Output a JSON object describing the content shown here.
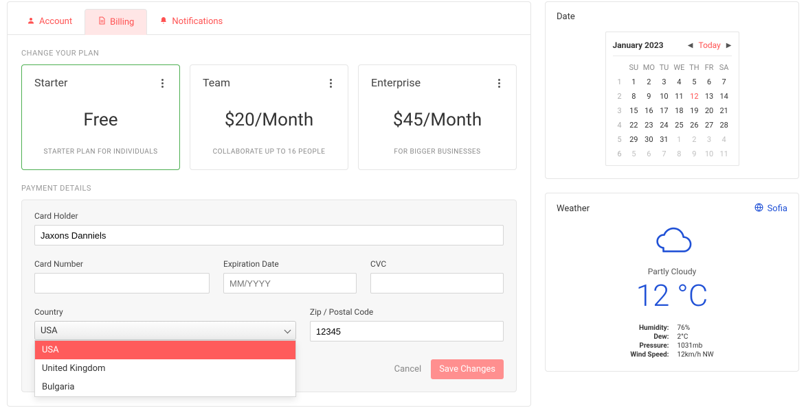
{
  "tabs": {
    "account": "Account",
    "billing": "Billing",
    "notifications": "Notifications"
  },
  "sections": {
    "plan_label": "CHANGE YOUR PLAN",
    "payment_label": "PAYMENT DETAILS"
  },
  "plans": [
    {
      "name": "Starter",
      "price": "Free",
      "desc": "STARTER PLAN FOR INDIVIDUALS",
      "selected": true
    },
    {
      "name": "Team",
      "price": "$20/Month",
      "desc": "COLLABORATE UP TO 16 PEOPLE",
      "selected": false
    },
    {
      "name": "Enterprise",
      "price": "$45/Month",
      "desc": "FOR BIGGER BUSINESSES",
      "selected": false
    }
  ],
  "form": {
    "card_holder": {
      "label": "Card Holder",
      "value": "Jaxons Danniels"
    },
    "card_number": {
      "label": "Card Number",
      "value": ""
    },
    "expiration": {
      "label": "Expiration Date",
      "placeholder": "MM/YYYY",
      "value": ""
    },
    "cvc": {
      "label": "CVC",
      "value": ""
    },
    "country": {
      "label": "Country",
      "value": "USA",
      "options": [
        "USA",
        "United Kingdom",
        "Bulgaria"
      ]
    },
    "zip": {
      "label": "Zip / Postal Code",
      "value": "12345"
    }
  },
  "actions": {
    "cancel": "Cancel",
    "save": "Save Changes"
  },
  "date_panel": {
    "title": "Date",
    "month": "January 2023",
    "today_label": "Today",
    "dow": [
      "SU",
      "MO",
      "TU",
      "WE",
      "TH",
      "FR",
      "SA"
    ],
    "weeks": [
      {
        "num": "1",
        "days": [
          {
            "d": "1"
          },
          {
            "d": "2"
          },
          {
            "d": "3"
          },
          {
            "d": "4"
          },
          {
            "d": "5"
          },
          {
            "d": "6"
          },
          {
            "d": "7"
          }
        ]
      },
      {
        "num": "2",
        "days": [
          {
            "d": "8"
          },
          {
            "d": "9"
          },
          {
            "d": "10"
          },
          {
            "d": "11"
          },
          {
            "d": "12",
            "today": true
          },
          {
            "d": "13"
          },
          {
            "d": "14"
          }
        ]
      },
      {
        "num": "3",
        "days": [
          {
            "d": "15"
          },
          {
            "d": "16"
          },
          {
            "d": "17"
          },
          {
            "d": "18"
          },
          {
            "d": "19"
          },
          {
            "d": "20"
          },
          {
            "d": "21"
          }
        ]
      },
      {
        "num": "4",
        "days": [
          {
            "d": "22"
          },
          {
            "d": "23"
          },
          {
            "d": "24"
          },
          {
            "d": "25"
          },
          {
            "d": "26"
          },
          {
            "d": "27"
          },
          {
            "d": "28"
          }
        ]
      },
      {
        "num": "5",
        "days": [
          {
            "d": "29"
          },
          {
            "d": "30"
          },
          {
            "d": "31"
          },
          {
            "d": "1",
            "other": true
          },
          {
            "d": "2",
            "other": true
          },
          {
            "d": "3",
            "other": true
          },
          {
            "d": "4",
            "other": true
          }
        ]
      },
      {
        "num": "6",
        "days": [
          {
            "d": "5",
            "other": true
          },
          {
            "d": "6",
            "other": true
          },
          {
            "d": "7",
            "other": true
          },
          {
            "d": "8",
            "other": true
          },
          {
            "d": "9",
            "other": true
          },
          {
            "d": "10",
            "other": true
          },
          {
            "d": "11",
            "other": true
          }
        ]
      }
    ]
  },
  "weather": {
    "title": "Weather",
    "location": "Sofia",
    "condition": "Partly Cloudy",
    "temp": "12 °C",
    "details": [
      {
        "k": "Humidity:",
        "v": "76%"
      },
      {
        "k": "Dew:",
        "v": "2°C"
      },
      {
        "k": "Pressure:",
        "v": "1031mb"
      },
      {
        "k": "Wind Speed:",
        "v": "12km/h NW"
      }
    ]
  }
}
